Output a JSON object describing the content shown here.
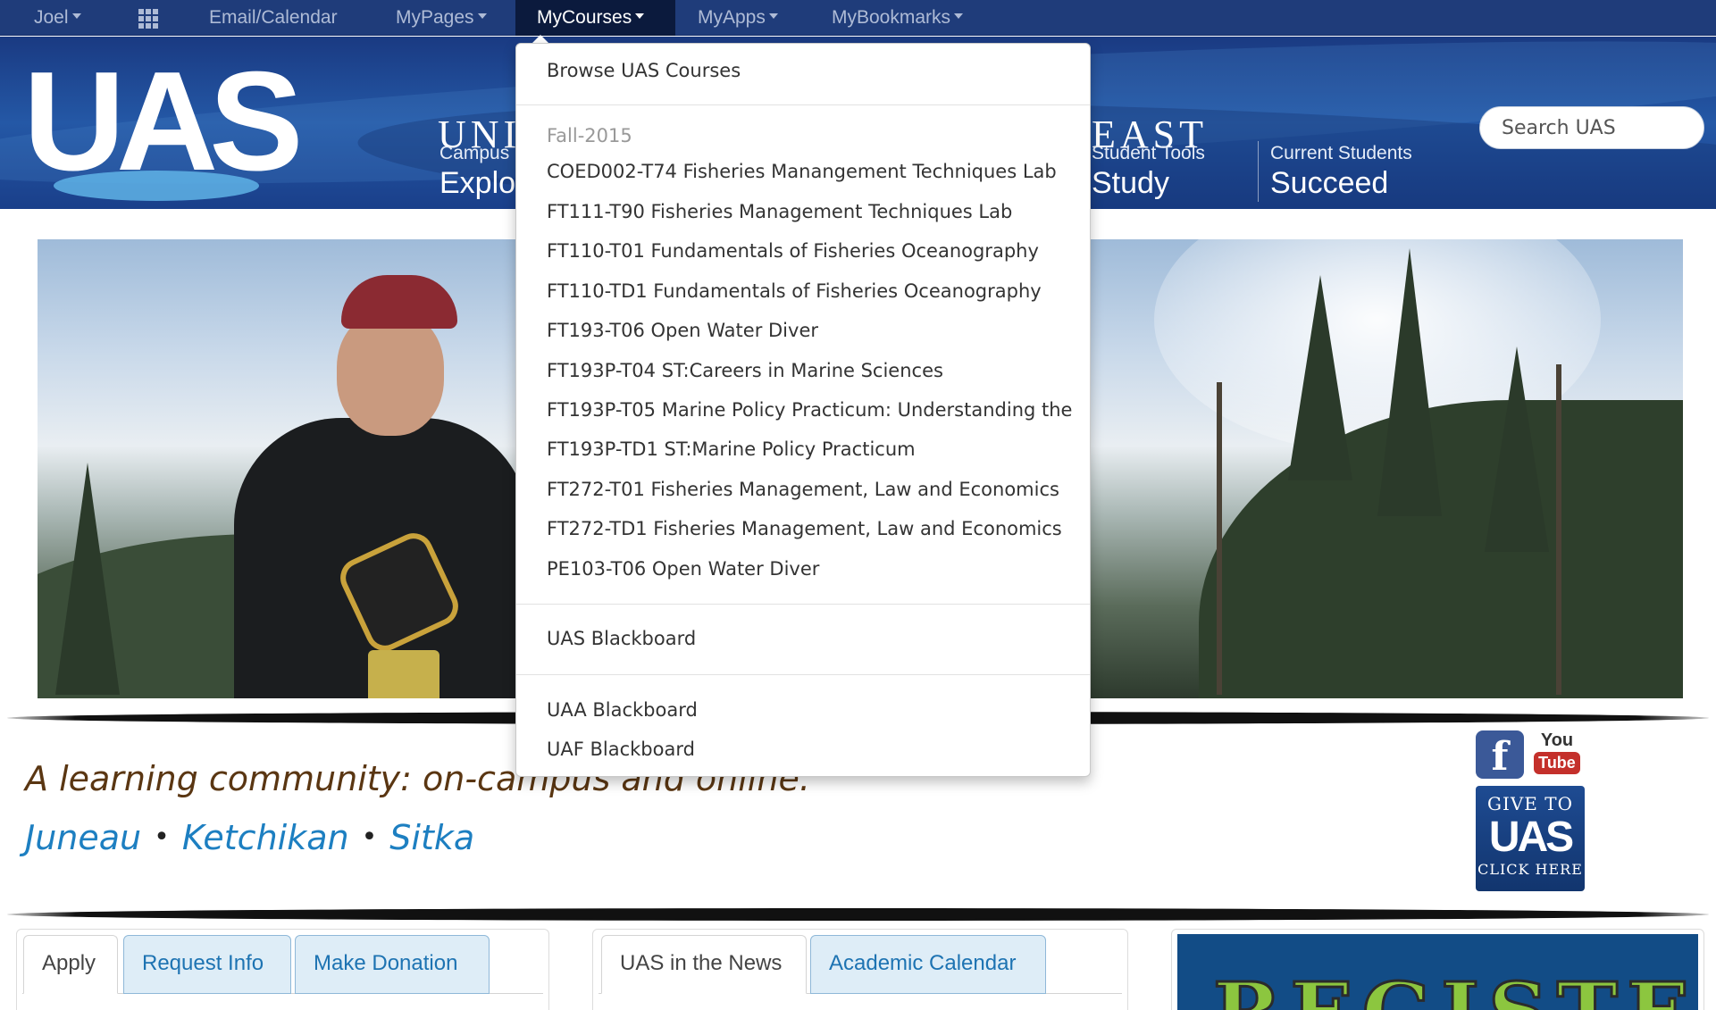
{
  "topbar": {
    "user": "Joel",
    "apps_icon": "apps-grid-icon",
    "items": [
      {
        "label": "Email/Calendar"
      },
      {
        "label": "MyPages"
      },
      {
        "label": "MyCourses"
      },
      {
        "label": "MyApps"
      },
      {
        "label": "MyBookmarks"
      }
    ]
  },
  "header": {
    "logo": "UAS",
    "title_left": "UNI",
    "title_right": "EAST",
    "nav": [
      {
        "small": "Campus",
        "big": "Explo"
      },
      {
        "small": "Student Tools",
        "big": "Study"
      },
      {
        "small": "Current Students",
        "big": "Succeed"
      }
    ],
    "search_placeholder": "Search UAS"
  },
  "dropdown": {
    "browse": "Browse UAS Courses",
    "term": "Fall-2015",
    "courses": [
      "COED002-T74 Fisheries Manangement Techniques Lab",
      "FT111-T90 Fisheries Management Techniques Lab",
      "FT110-T01 Fundamentals of Fisheries Oceanography",
      "FT110-TD1 Fundamentals of Fisheries Oceanography",
      "FT193-T06 Open Water Diver",
      "FT193P-T04 ST:Careers in Marine Sciences",
      "FT193P-T05 Marine Policy Practicum: Understanding the",
      "FT193P-TD1 ST:Marine Policy Practicum",
      "FT272-T01 Fisheries Management, Law and Economics",
      "FT272-TD1 Fisheries Management, Law and Economics",
      "PE103-T06 Open Water Diver"
    ],
    "uas_blackboard": "UAS Blackboard",
    "uaa_blackboard": "UAA Blackboard",
    "uaf_blackboard": "UAF Blackboard"
  },
  "main": {
    "tagline": "A learning community: on-campus and online.",
    "campuses": [
      "Juneau",
      "Ketchikan",
      "Sitka"
    ],
    "social": {
      "facebook": "f",
      "youtube_top": "You",
      "youtube_bottom": "Tube"
    },
    "give": {
      "top": "GIVE TO",
      "mid": "UAS",
      "bottom": "CLICK HERE"
    },
    "panel1_tabs": [
      "Apply",
      "Request Info",
      "Make Donation"
    ],
    "panel2_tabs": [
      "UAS in the News",
      "Academic Calendar"
    ],
    "banner": "REGISTER"
  },
  "colors": {
    "topbar": "#1f3c7a",
    "link": "#1d7fc1",
    "tagline": "#5a3612",
    "banner_text": "#8cc63f"
  }
}
